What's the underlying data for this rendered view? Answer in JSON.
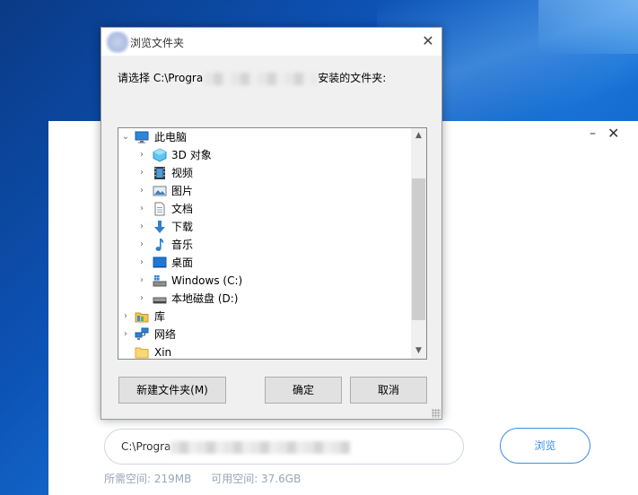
{
  "installer": {
    "path_prefix": "C:\\Progra",
    "browse_label": "浏览",
    "required_space": "所需空间: 219MB",
    "available_space": "可用空间: 37.6GB"
  },
  "dialog": {
    "title": "浏览文件夹",
    "prompt_prefix": "请选择 C:\\Progra",
    "prompt_suffix": "安装的文件夹:",
    "tree": [
      {
        "label": "此电脑",
        "icon": "computer-icon"
      },
      {
        "label": "3D 对象",
        "icon": "3d-objects-icon"
      },
      {
        "label": "视频",
        "icon": "video-icon"
      },
      {
        "label": "图片",
        "icon": "pictures-icon"
      },
      {
        "label": "文档",
        "icon": "documents-icon"
      },
      {
        "label": "下载",
        "icon": "download-icon"
      },
      {
        "label": "音乐",
        "icon": "music-icon"
      },
      {
        "label": "桌面",
        "icon": "desktop-icon"
      },
      {
        "label": "Windows (C:)",
        "icon": "windows-drive-icon"
      },
      {
        "label": "本地磁盘 (D:)",
        "icon": "local-disk-icon"
      },
      {
        "label": "库",
        "icon": "library-icon"
      },
      {
        "label": "网络",
        "icon": "network-icon"
      },
      {
        "label": "Xin",
        "icon": "folder-icon"
      }
    ],
    "buttons": {
      "new_folder": "新建文件夹(M)",
      "ok": "确定",
      "cancel": "取消"
    }
  },
  "colors": {
    "accent": "#3a8de0",
    "selection_blue": "#0078d7"
  }
}
